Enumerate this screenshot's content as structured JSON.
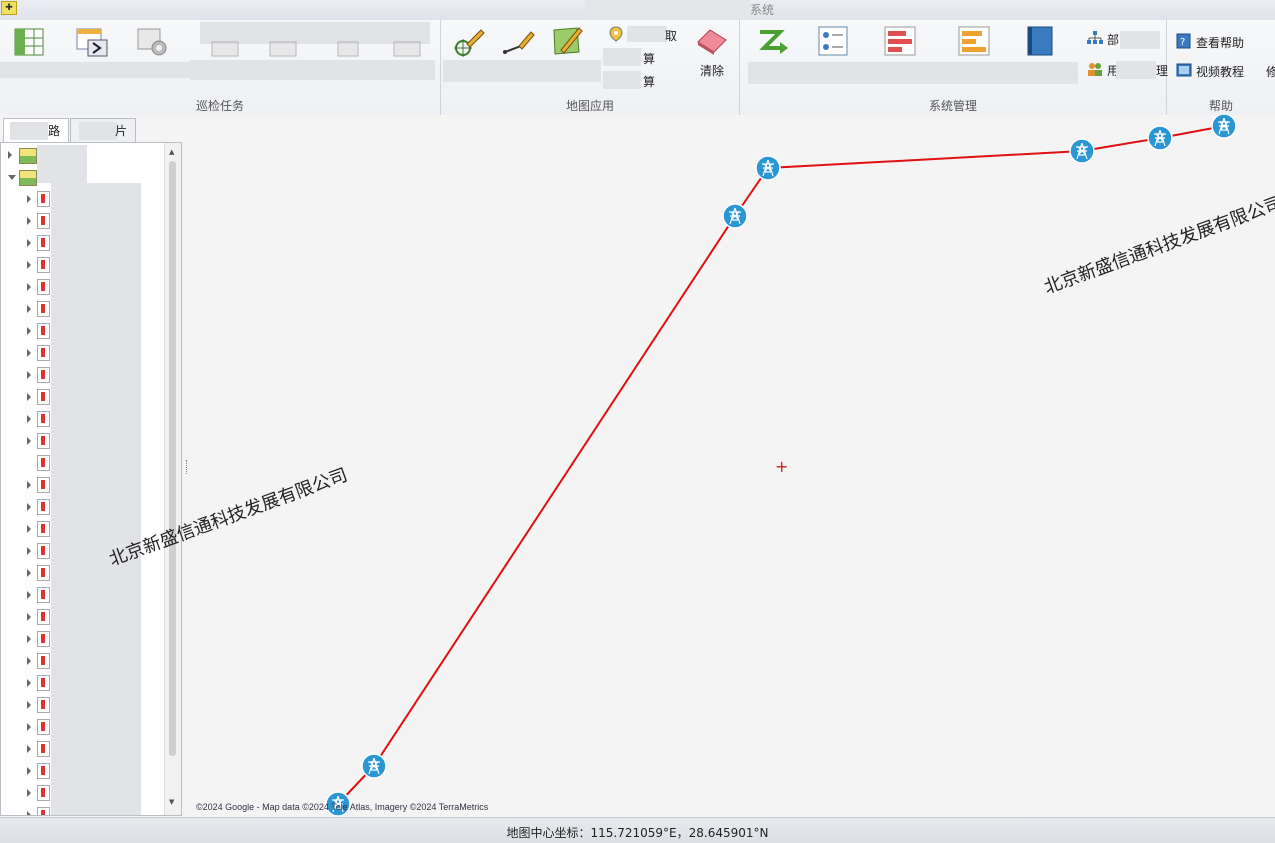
{
  "window": {
    "title": "系统",
    "app_icon": "app-icon"
  },
  "ribbon": {
    "groups": [
      {
        "label": "巡检任务"
      },
      {
        "label": "地图应用"
      },
      {
        "label": "系统管理"
      },
      {
        "label": "帮助"
      }
    ],
    "map_app": {
      "item1_suffix": "取",
      "item2_suffix": "算",
      "item3_suffix": "算",
      "clear_label": "清除"
    },
    "sys_mgmt": {
      "item1_prefix": "部",
      "item2_prefix": "用",
      "item2_suffix": "理"
    },
    "help": {
      "view_help": "查看帮助",
      "video_tutorial": "视频教程",
      "extra": "修"
    }
  },
  "left_panel": {
    "tabs": [
      {
        "label": "路"
      },
      {
        "label": "片"
      }
    ],
    "tree": {
      "roots": 2,
      "child_count": 29
    }
  },
  "map": {
    "crosshair": "+",
    "watermarks": [
      "北京新盛信通科技发展有限公司",
      "北京新盛信通科技发展有限公司"
    ],
    "copyright": "©2024 Google - Map data ©2024 Tele Atlas, Imagery ©2024 TerraMetrics",
    "accent_line": "#e01010",
    "tower_color": "#2a96d4"
  },
  "status": {
    "center_coord": "地图中心坐标：115.721059°E，28.645901°N"
  }
}
